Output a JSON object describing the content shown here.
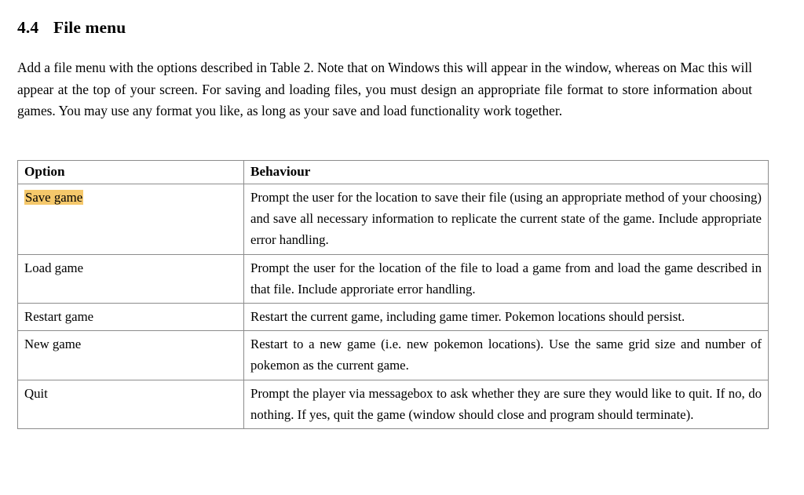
{
  "document": {
    "section": {
      "number": "4.4",
      "title": "File menu"
    },
    "intro_paragraph": "Add a file menu with the options described in Table 2. Note that on Windows this will appear in the window, whereas on Mac this will appear at the top of your screen. For saving and loading files, you must design an appropriate file format to store information about games. You may use any format you like, as long as your save and load functionality work together."
  },
  "table": {
    "headers": {
      "option": "Option",
      "behaviour": "Behaviour"
    },
    "highlight_color": "#f5c86b",
    "border_color": "#8c8c8c",
    "rows": [
      {
        "option": "Save game",
        "highlighted": true,
        "behaviour": "Prompt the user for the location to save their file (using an appropriate method of your choosing) and save all necessary information to replicate the current state of the game. Include appropriate error handling."
      },
      {
        "option": "Load game",
        "highlighted": false,
        "behaviour": "Prompt the user for the location of the file to load a game from and load the game described in that file. Include approriate error handling."
      },
      {
        "option": "Restart game",
        "highlighted": false,
        "behaviour": "Restart the current game, including game timer. Pokemon locations should persist."
      },
      {
        "option": "New game",
        "highlighted": false,
        "behaviour": "Restart to a new game (i.e. new pokemon locations). Use the same grid size and number of pokemon as the current game."
      },
      {
        "option": "Quit",
        "highlighted": false,
        "behaviour": "Prompt the player via messagebox to ask whether they are sure they would like to quit. If no, do nothing. If yes, quit the game (window should close and program should terminate)."
      }
    ]
  }
}
